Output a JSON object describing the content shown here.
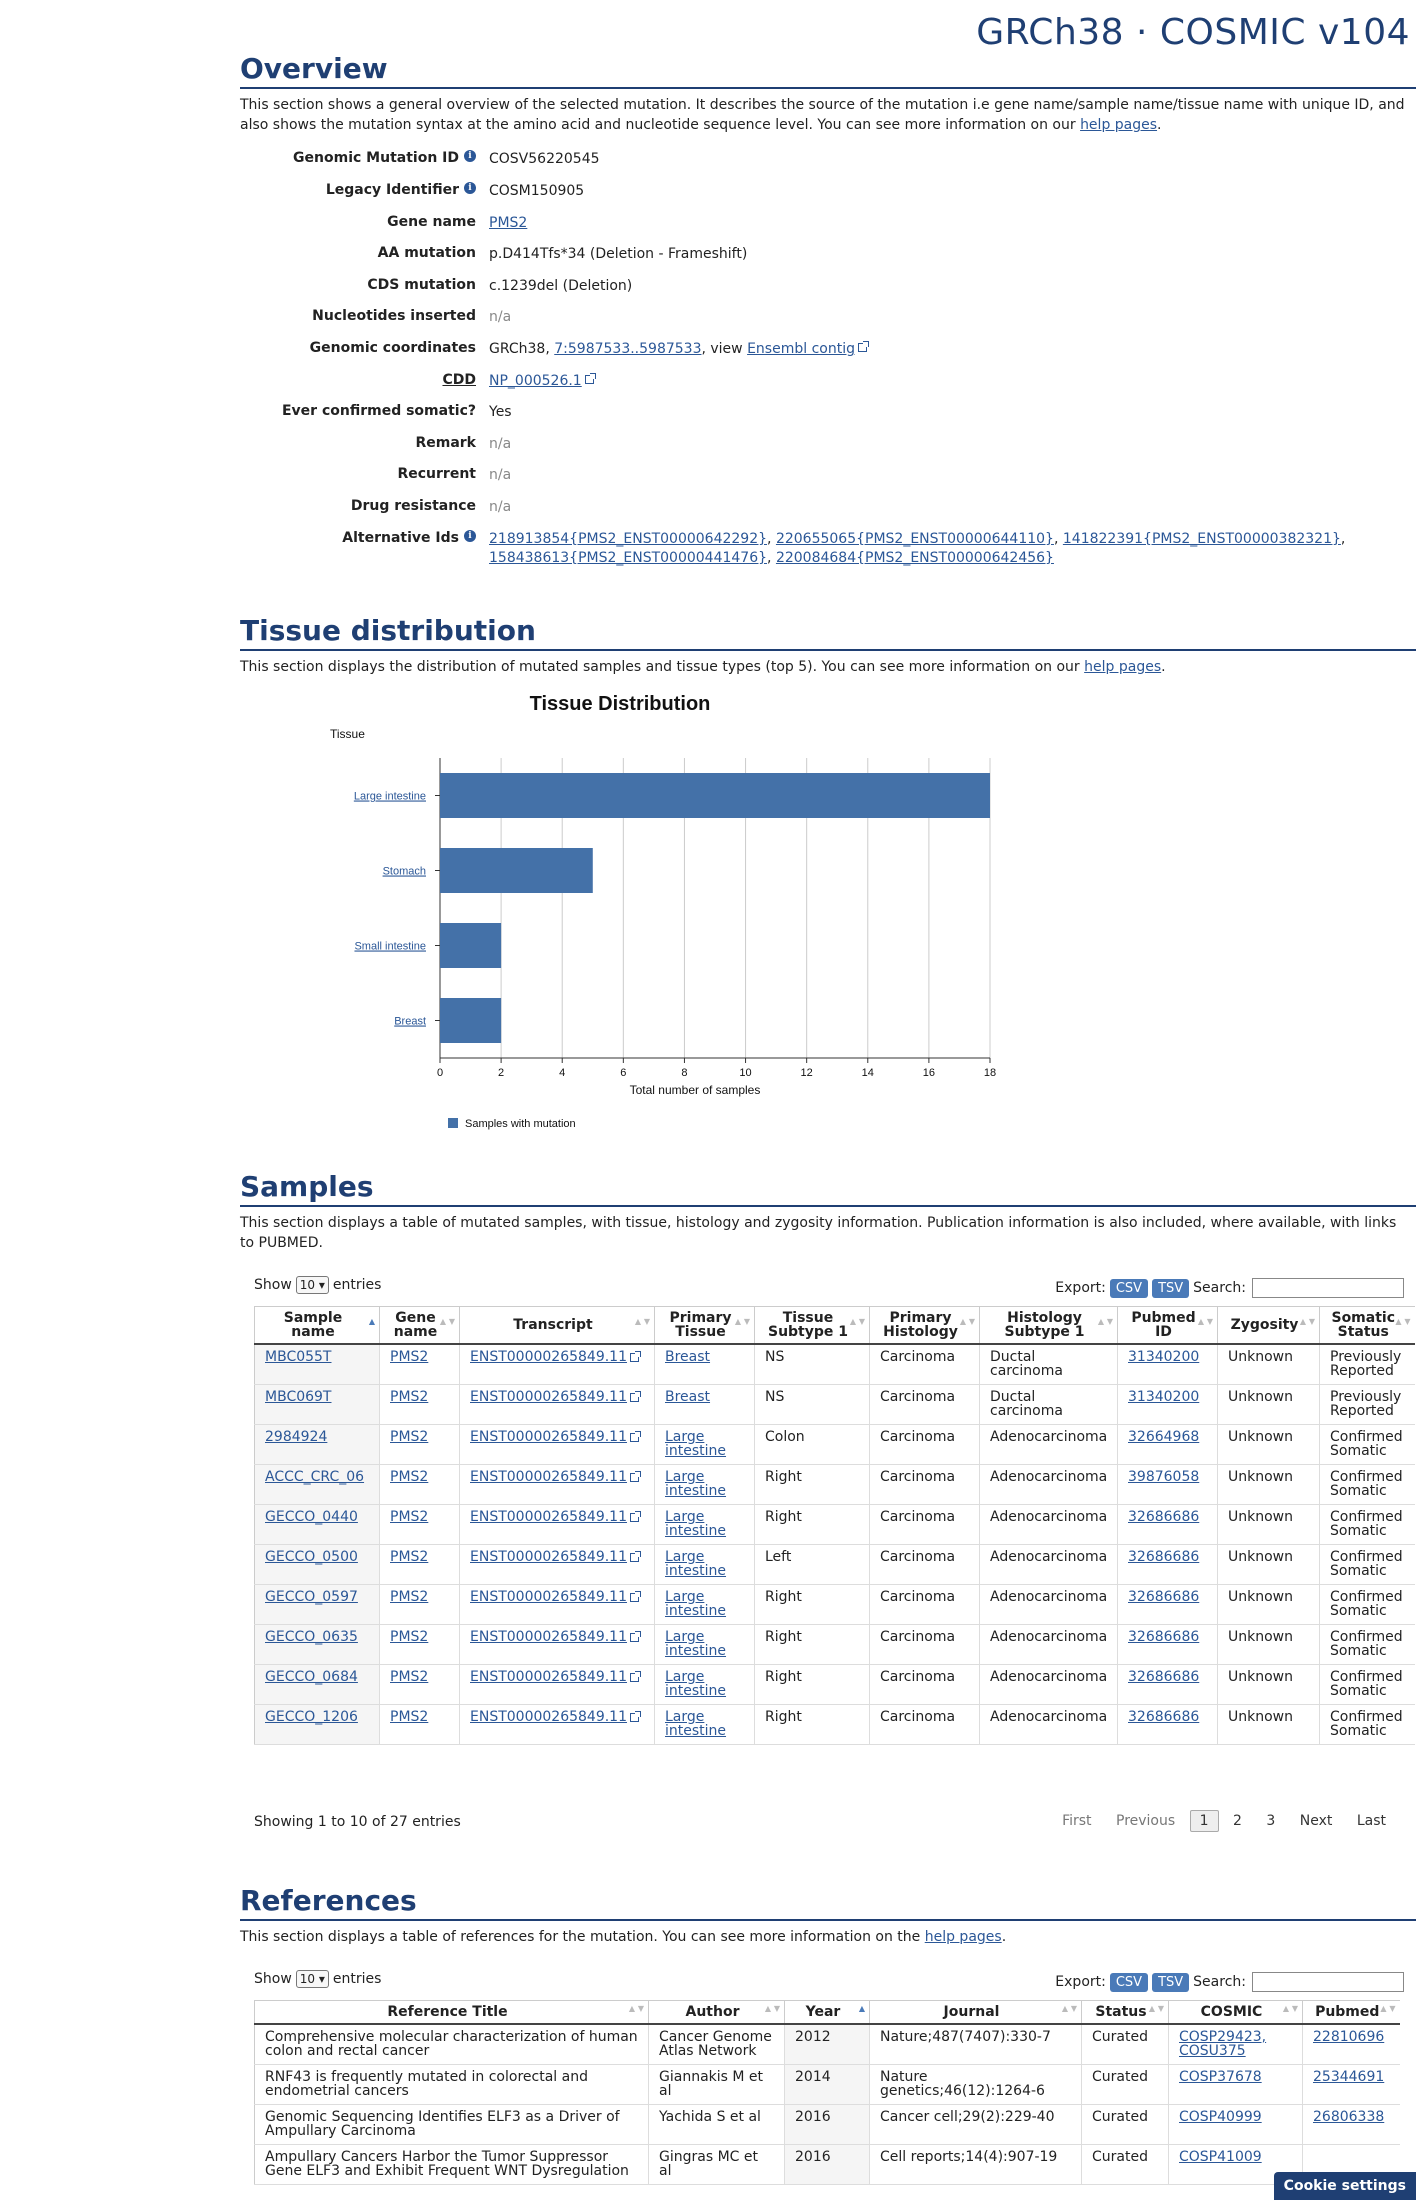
{
  "header": {
    "brand": "GRCh38 · COSMIC v104"
  },
  "overview": {
    "title": "Overview",
    "description_a": "This section shows a general overview of the selected mutation. It describes the source of the mutation i.e gene name/sample name/tissue name with unique ID, and also shows the mutation syntax at the amino acid and nucleotide sequence level. You can see more information on our ",
    "description_link": "help pages",
    "description_b": ".",
    "genomic_mutation_id": {
      "label": "Genomic Mutation ID",
      "value": "COSV56220545"
    },
    "legacy_identifier": {
      "label": "Legacy Identifier",
      "value": "COSM150905"
    },
    "gene_name": {
      "label": "Gene name",
      "value": "PMS2"
    },
    "aa_mutation": {
      "label": "AA mutation",
      "value": "p.D414Tfs*34 (Deletion - Frameshift)"
    },
    "cds_mutation": {
      "label": "CDS mutation",
      "value": "c.1239del (Deletion)"
    },
    "nucleotides_inserted": {
      "label": "Nucleotides inserted",
      "value": "n/a"
    },
    "genomic_coordinates": {
      "label": "Genomic coordinates",
      "prefix": "GRCh38, ",
      "coords": "7:5987533..5987533",
      "middle": ", view ",
      "ensembl": "Ensembl contig"
    },
    "cdd": {
      "label": "CDD",
      "value": "NP_000526.1"
    },
    "ever_confirmed_somatic": {
      "label": "Ever confirmed somatic?",
      "value": "Yes"
    },
    "remark": {
      "label": "Remark",
      "value": "n/a"
    },
    "recurrent": {
      "label": "Recurrent",
      "value": "n/a"
    },
    "drug_resistance": {
      "label": "Drug resistance",
      "value": "n/a"
    },
    "alternative_ids": {
      "label": "Alternative Ids",
      "ids": [
        "218913854{PMS2_ENST00000642292}",
        "220655065{PMS2_ENST00000644110}",
        "141822391{PMS2_ENST00000382321}",
        "158438613{PMS2_ENST00000441476}",
        "220084684{PMS2_ENST00000642456}"
      ]
    }
  },
  "tissue": {
    "title": "Tissue distribution",
    "description_a": "This section displays the distribution of mutated samples and tissue types (top 5). You can see more information on our ",
    "description_link": "help pages",
    "description_b": "."
  },
  "chart_data": {
    "type": "bar",
    "orientation": "horizontal",
    "title": "Tissue Distribution",
    "ylabel": "Tissue",
    "xlabel": "Total number of samples",
    "categories": [
      "Large intestine",
      "Stomach",
      "Small intestine",
      "Breast"
    ],
    "series": [
      {
        "name": "Samples with mutation",
        "values": [
          18,
          5,
          2,
          2
        ],
        "color": "#4471a8"
      }
    ],
    "xlim": [
      0,
      18
    ],
    "xticks": [
      0,
      2,
      4,
      6,
      8,
      10,
      12,
      14,
      16,
      18
    ],
    "grid": true,
    "legend": "bottom-left"
  },
  "samples": {
    "title": "Samples",
    "description": "This section displays a table of mutated samples, with tissue, histology and zygosity information. Publication information is also included, where available, with links to PUBMED.",
    "show": "Show",
    "entries_value": "10",
    "entries": "entries",
    "export": "Export:",
    "csv": "CSV",
    "tsv": "TSV",
    "search": "Search:",
    "columns": [
      [
        "Sample",
        "name"
      ],
      [
        "Gene",
        "name"
      ],
      [
        "Transcript",
        ""
      ],
      [
        "Primary",
        "Tissue"
      ],
      [
        "Tissue",
        "Subtype 1"
      ],
      [
        "Primary",
        "Histology"
      ],
      [
        "Histology",
        "Subtype 1"
      ],
      [
        "Pubmed",
        "ID"
      ],
      [
        "Zygosity",
        ""
      ],
      [
        "Somatic",
        "Status"
      ]
    ],
    "rows": [
      [
        "MBC055T",
        "PMS2",
        "ENST00000265849.11",
        [
          "Breast",
          ""
        ],
        "NS",
        "Carcinoma",
        [
          "Ductal",
          "carcinoma"
        ],
        "31340200",
        "Unknown",
        [
          "Previously",
          "Reported"
        ]
      ],
      [
        "MBC069T",
        "PMS2",
        "ENST00000265849.11",
        [
          "Breast",
          ""
        ],
        "NS",
        "Carcinoma",
        [
          "Ductal",
          "carcinoma"
        ],
        "31340200",
        "Unknown",
        [
          "Previously",
          "Reported"
        ]
      ],
      [
        "2984924",
        "PMS2",
        "ENST00000265849.11",
        [
          "Large",
          "intestine"
        ],
        "Colon",
        "Carcinoma",
        [
          "Adenocarcinoma",
          ""
        ],
        "32664968",
        "Unknown",
        [
          "Confirmed",
          "Somatic"
        ]
      ],
      [
        "ACCC_CRC_06",
        "PMS2",
        "ENST00000265849.11",
        [
          "Large",
          "intestine"
        ],
        "Right",
        "Carcinoma",
        [
          "Adenocarcinoma",
          ""
        ],
        "39876058",
        "Unknown",
        [
          "Confirmed",
          "Somatic"
        ]
      ],
      [
        "GECCO_0440",
        "PMS2",
        "ENST00000265849.11",
        [
          "Large",
          "intestine"
        ],
        "Right",
        "Carcinoma",
        [
          "Adenocarcinoma",
          ""
        ],
        "32686686",
        "Unknown",
        [
          "Confirmed",
          "Somatic"
        ]
      ],
      [
        "GECCO_0500",
        "PMS2",
        "ENST00000265849.11",
        [
          "Large",
          "intestine"
        ],
        "Left",
        "Carcinoma",
        [
          "Adenocarcinoma",
          ""
        ],
        "32686686",
        "Unknown",
        [
          "Confirmed",
          "Somatic"
        ]
      ],
      [
        "GECCO_0597",
        "PMS2",
        "ENST00000265849.11",
        [
          "Large",
          "intestine"
        ],
        "Right",
        "Carcinoma",
        [
          "Adenocarcinoma",
          ""
        ],
        "32686686",
        "Unknown",
        [
          "Confirmed",
          "Somatic"
        ]
      ],
      [
        "GECCO_0635",
        "PMS2",
        "ENST00000265849.11",
        [
          "Large",
          "intestine"
        ],
        "Right",
        "Carcinoma",
        [
          "Adenocarcinoma",
          ""
        ],
        "32686686",
        "Unknown",
        [
          "Confirmed",
          "Somatic"
        ]
      ],
      [
        "GECCO_0684",
        "PMS2",
        "ENST00000265849.11",
        [
          "Large",
          "intestine"
        ],
        "Right",
        "Carcinoma",
        [
          "Adenocarcinoma",
          ""
        ],
        "32686686",
        "Unknown",
        [
          "Confirmed",
          "Somatic"
        ]
      ],
      [
        "GECCO_1206",
        "PMS2",
        "ENST00000265849.11",
        [
          "Large",
          "intestine"
        ],
        "Right",
        "Carcinoma",
        [
          "Adenocarcinoma",
          ""
        ],
        "32686686",
        "Unknown",
        [
          "Confirmed",
          "Somatic"
        ]
      ]
    ],
    "info": "Showing 1 to 10 of 27 entries",
    "pager": {
      "first": "First",
      "previous": "Previous",
      "pages": [
        "1",
        "2",
        "3"
      ],
      "next": "Next",
      "last": "Last"
    }
  },
  "references": {
    "title": "References",
    "description_a": "This section displays a table of references for the mutation. You can see more information on the ",
    "description_link": "help pages",
    "description_b": ".",
    "show": "Show",
    "entries_value": "10",
    "entries": "entries",
    "export": "Export:",
    "csv": "CSV",
    "tsv": "TSV",
    "search": "Search:",
    "columns": [
      "Reference Title",
      "Author",
      "Year",
      "Journal",
      "Status",
      "COSMIC",
      "Pubmed"
    ],
    "rows": [
      [
        [
          "Comprehensive molecular characterization of human",
          "colon and rectal cancer"
        ],
        [
          "Cancer Genome",
          "Atlas Network"
        ],
        "2012",
        [
          "Nature;487(7407):330-7",
          ""
        ],
        "Curated",
        [
          "COSP29423,",
          "COSU375"
        ],
        "22810696"
      ],
      [
        [
          "RNF43 is frequently mutated in colorectal and",
          "endometrial cancers"
        ],
        [
          "Giannakis M et",
          "al"
        ],
        "2014",
        [
          "Nature",
          "genetics;46(12):1264-6"
        ],
        "Curated",
        [
          "COSP37678",
          ""
        ],
        "25344691"
      ],
      [
        [
          "Genomic Sequencing Identifies ELF3 as a Driver of",
          "Ampullary Carcinoma"
        ],
        [
          "Yachida S et al",
          ""
        ],
        "2016",
        [
          "Cancer cell;29(2):229-40",
          ""
        ],
        "Curated",
        [
          "COSP40999",
          ""
        ],
        "26806338"
      ],
      [
        [
          "Ampullary Cancers Harbor the Tumor Suppressor",
          "Gene ELF3 and Exhibit Frequent WNT Dysregulation"
        ],
        [
          "Gingras MC et",
          "al"
        ],
        "2016",
        [
          "Cell reports;14(4):907-19",
          ""
        ],
        "Curated",
        [
          "COSP41009",
          ""
        ],
        ""
      ]
    ]
  },
  "cookie": {
    "label": "Cookie settings"
  }
}
